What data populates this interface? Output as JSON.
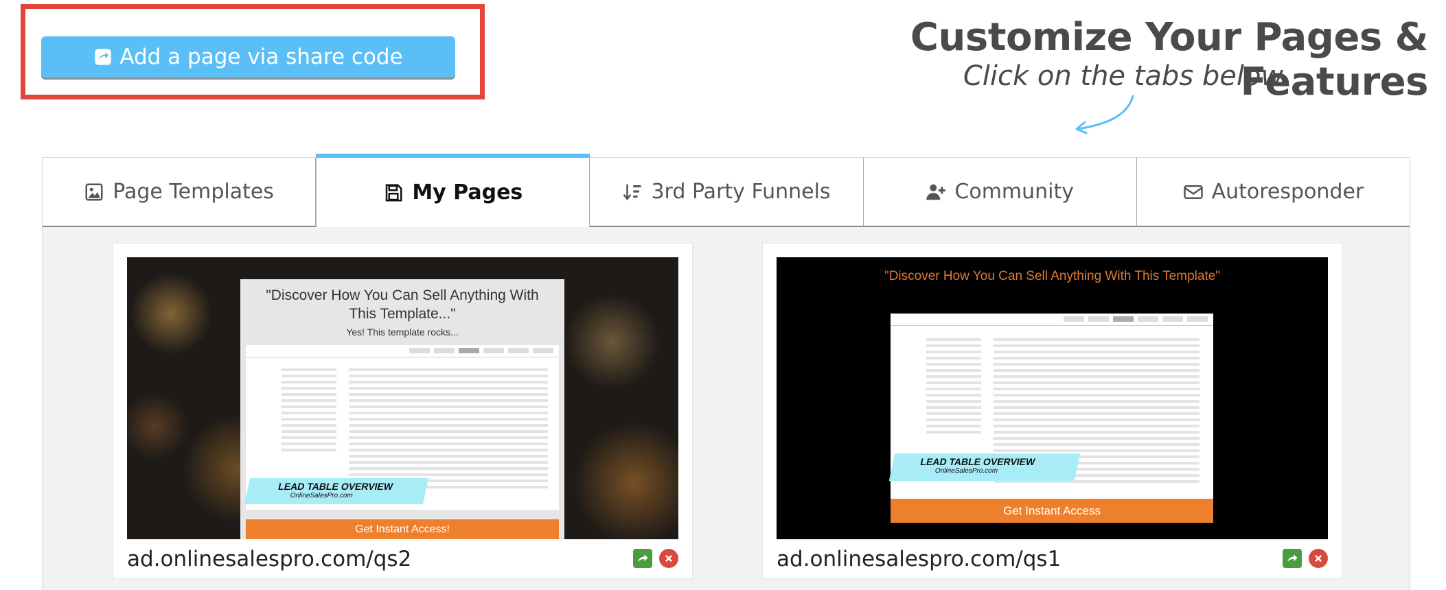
{
  "share_button": {
    "label": "Add a page via share code"
  },
  "header": {
    "title": "Customize Your Pages & Features",
    "subtitle": "Click on the tabs below"
  },
  "tabs": [
    {
      "label": "Page Templates",
      "icon": "image-icon",
      "active": false
    },
    {
      "label": "My Pages",
      "icon": "floppy-icon",
      "active": true
    },
    {
      "label": "3rd Party Funnels",
      "icon": "sort-icon",
      "active": false
    },
    {
      "label": "Community",
      "icon": "user-plus-icon",
      "active": false
    },
    {
      "label": "Autoresponder",
      "icon": "envelope-icon",
      "active": false
    }
  ],
  "pages": [
    {
      "url": "ad.onlinesalespro.com/qs2",
      "thumb_title": "\"Discover How You Can Sell Anything With This Template...\"",
      "thumb_subtitle": "Yes! This template rocks...",
      "ribbon_title": "LEAD TABLE OVERVIEW",
      "ribbon_sub": "OnlineSalesPro.com",
      "cta": "Get Instant Access!"
    },
    {
      "url": "ad.onlinesalespro.com/qs1",
      "thumb_title": "\"Discover How You Can Sell Anything With This Template\"",
      "ribbon_title": "LEAD TABLE OVERVIEW",
      "ribbon_sub": "OnlineSalesPro.com",
      "cta": "Get Instant Access"
    }
  ],
  "colors": {
    "accent": "#5bbff7",
    "highlight": "#e4453a",
    "cta": "#ee7f2d",
    "share_action": "#4a9d3f",
    "delete_action": "#d9493e"
  }
}
